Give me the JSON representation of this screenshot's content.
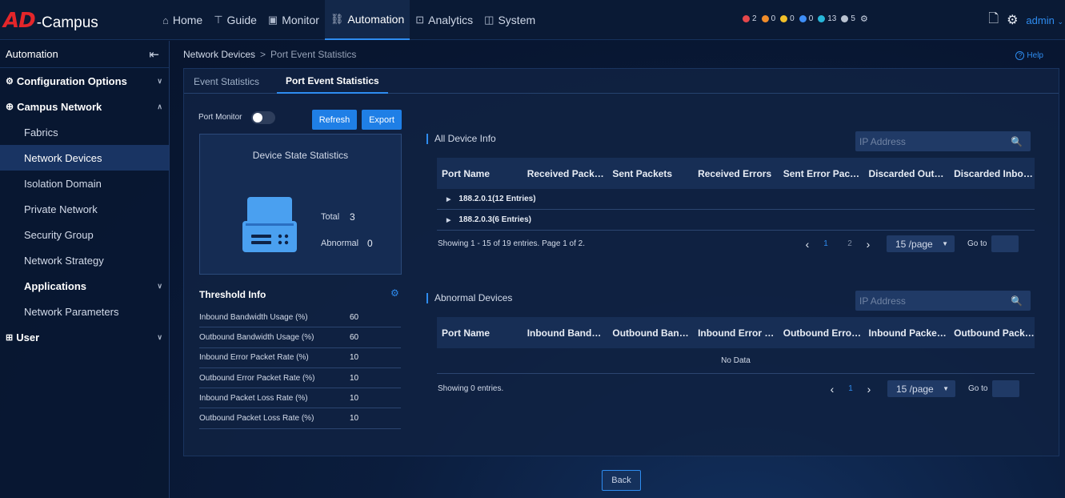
{
  "app": {
    "logo_ad": "AD",
    "logo_campus": "-Campus"
  },
  "nav": {
    "items": [
      {
        "label": "Home",
        "icon": "home-icon"
      },
      {
        "label": "Guide",
        "icon": "signpost-icon"
      },
      {
        "label": "Monitor",
        "icon": "monitor-icon"
      },
      {
        "label": "Automation",
        "icon": "automation-icon",
        "active": true
      },
      {
        "label": "Analytics",
        "icon": "analytics-icon"
      },
      {
        "label": "System",
        "icon": "system-icon"
      }
    ]
  },
  "alarms": [
    {
      "count": "2",
      "color": "#e5474b"
    },
    {
      "count": "0",
      "color": "#f08c2a"
    },
    {
      "count": "0",
      "color": "#f2c029"
    },
    {
      "count": "0",
      "color": "#3e8ef7"
    },
    {
      "count": "13",
      "color": "#27b7d9"
    },
    {
      "count": "5",
      "color": "#b9c2d0"
    }
  ],
  "header_right": {
    "user": "admin"
  },
  "sidebar": {
    "title": "Automation",
    "items": [
      {
        "label": "Configuration Options",
        "type": "group",
        "expanded": false
      },
      {
        "label": "Campus Network",
        "type": "group",
        "expanded": true
      },
      {
        "label": "Fabrics",
        "type": "sub"
      },
      {
        "label": "Network Devices",
        "type": "sub",
        "active": true
      },
      {
        "label": "Isolation Domain",
        "type": "sub"
      },
      {
        "label": "Private Network",
        "type": "sub"
      },
      {
        "label": "Security Group",
        "type": "sub"
      },
      {
        "label": "Network Strategy",
        "type": "sub"
      },
      {
        "label": "Applications",
        "type": "subgroup",
        "expanded": false
      },
      {
        "label": "Network Parameters",
        "type": "sub"
      },
      {
        "label": "User",
        "type": "group",
        "expanded": false
      }
    ]
  },
  "breadcrumb": {
    "parent": "Network Devices",
    "sep": ">",
    "current": "Port Event Statistics"
  },
  "help": "Help",
  "tabs": [
    {
      "label": "Event Statistics"
    },
    {
      "label": "Port Event Statistics",
      "active": true
    }
  ],
  "left": {
    "port_monitor_label": "Port Monitor",
    "port_monitor_on": false,
    "refresh": "Refresh",
    "export": "Export",
    "state_title": "Device State Statistics",
    "total_label": "Total",
    "total_value": "3",
    "abnormal_label": "Abnormal",
    "abnormal_value": "0",
    "threshold_title": "Threshold Info",
    "thresholds": [
      {
        "name": "Inbound Bandwidth Usage (%)",
        "value": "60"
      },
      {
        "name": "Outbound Bandwidth Usage (%)",
        "value": "60"
      },
      {
        "name": "Inbound Error Packet Rate (%)",
        "value": "10"
      },
      {
        "name": "Outbound Error Packet Rate (%)",
        "value": "10"
      },
      {
        "name": "Inbound Packet Loss Rate (%)",
        "value": "10"
      },
      {
        "name": "Outbound Packet Loss Rate (%)",
        "value": "10"
      }
    ]
  },
  "all_devices": {
    "title": "All Device Info",
    "search_placeholder": "IP Address",
    "columns": [
      "Port Name",
      "Received Packets",
      "Sent Packets",
      "Received Errors",
      "Sent Error Packets",
      "Discarded Outbound",
      "Discarded Inbound"
    ],
    "groups": [
      "188.2.0.1(12 Entries)",
      "188.2.0.3(6 Entries)"
    ],
    "showing": "Showing 1 - 15 of 19 entries. Page 1 of 2.",
    "pages": [
      "1",
      "2"
    ],
    "page_size": "15 /page",
    "goto": "Go to"
  },
  "abnormal_devices": {
    "title": "Abnormal Devices",
    "search_placeholder": "IP Address",
    "columns": [
      "Port Name",
      "Inbound Bandwidth",
      "Outbound Bandwidth",
      "Inbound Error Packets",
      "Outbound Error Packets",
      "Inbound Packet Loss",
      "Outbound Packet Loss"
    ],
    "empty": "No Data",
    "showing": "Showing 0 entries.",
    "pages": [
      "1"
    ],
    "page_size": "15 /page",
    "goto": "Go to"
  },
  "back": "Back"
}
